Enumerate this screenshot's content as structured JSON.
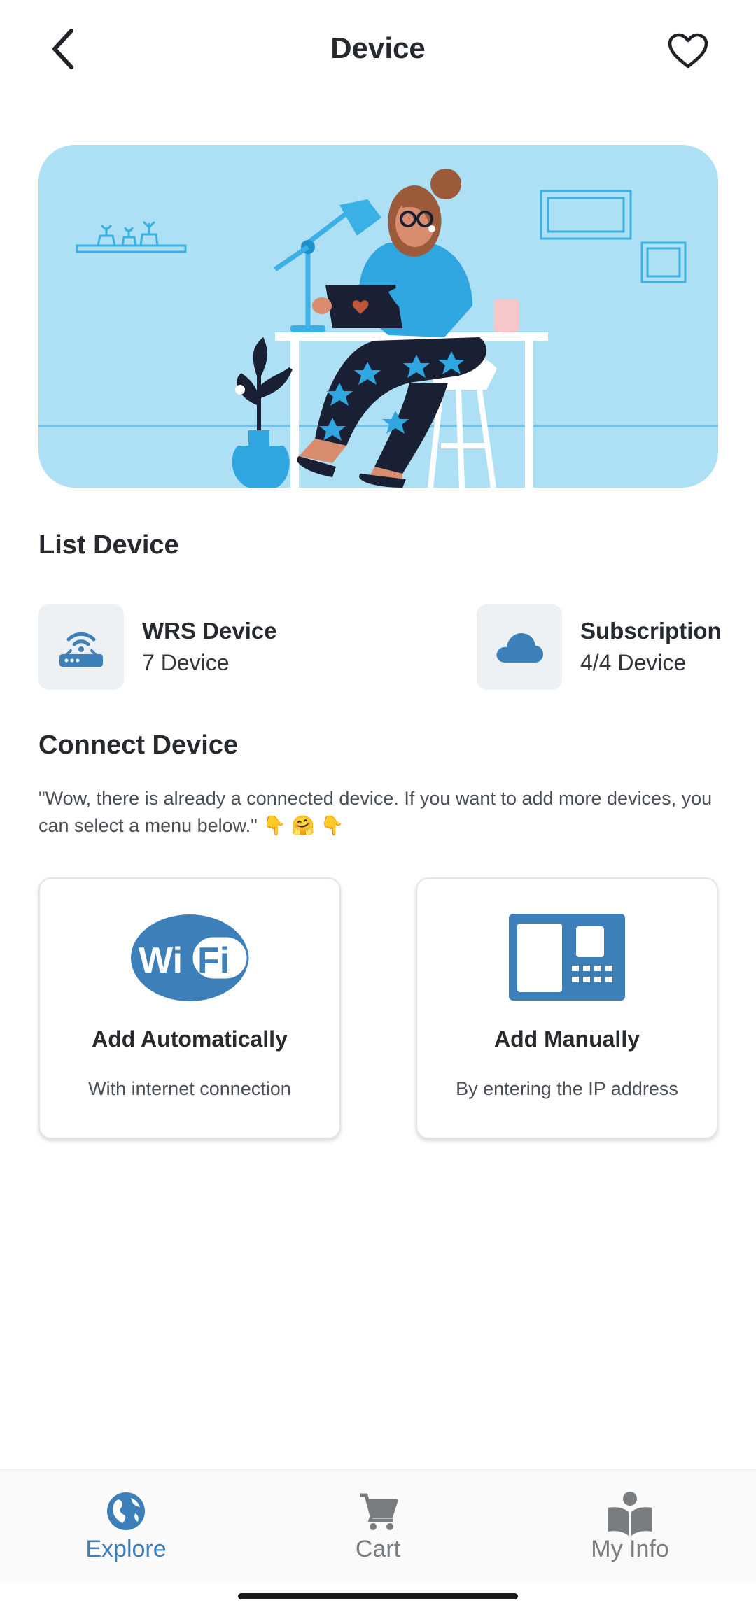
{
  "header": {
    "title": "Device",
    "back_icon": "chevron-left-icon",
    "favorite_icon": "heart-outline-icon"
  },
  "hero": {
    "image": "woman-working-at-desk-illustration"
  },
  "list_device": {
    "title": "List Device",
    "items": [
      {
        "title": "WRS Device",
        "subtitle": "7 Device",
        "icon": "router-icon"
      },
      {
        "title": "Subscription",
        "subtitle": "4/4 Device",
        "icon": "cloud-icon"
      }
    ]
  },
  "connect_device": {
    "title": "Connect Device",
    "description": "\"Wow, there is already a connected device. If you want to add more devices, you can select a menu below.\" 👇 🤗 👇",
    "options": [
      {
        "title": "Add Automatically",
        "subtitle": "With internet connection",
        "icon": "wifi-icon"
      },
      {
        "title": "Add Manually",
        "subtitle": "By entering the IP address",
        "icon": "ip-panel-icon"
      }
    ]
  },
  "bottom_nav": {
    "items": [
      {
        "label": "Explore",
        "icon": "globe-icon",
        "active": true
      },
      {
        "label": "Cart",
        "icon": "cart-icon",
        "active": false
      },
      {
        "label": "My Info",
        "icon": "person-book-icon",
        "active": false
      }
    ]
  },
  "colors": {
    "accent": "#3d7fb8",
    "nav_inactive": "#7a7d80",
    "hero_bg": "#aee0f5",
    "icon_tile_bg": "#eef1f4"
  }
}
